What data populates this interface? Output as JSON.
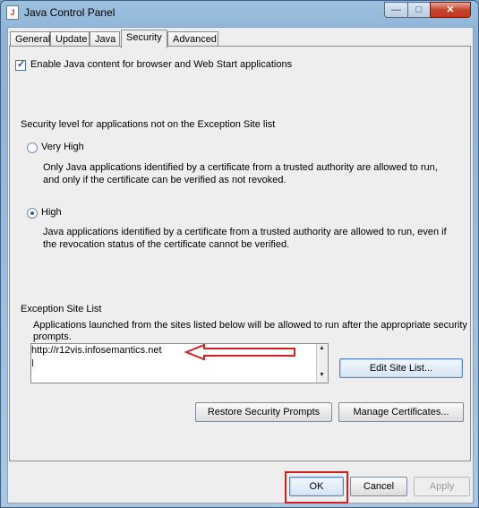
{
  "window": {
    "title": "Java Control Panel",
    "app_icon_glyph": "J",
    "minimize_glyph": "—",
    "maximize_glyph": "□",
    "close_glyph": "✕"
  },
  "tabs": [
    {
      "label": "General"
    },
    {
      "label": "Update"
    },
    {
      "label": "Java"
    },
    {
      "label": "Security"
    },
    {
      "label": "Advanced"
    }
  ],
  "security": {
    "enable_checkbox_label": "Enable Java content for browser and Web Start applications",
    "enable_checked": true,
    "level_heading": "Security level for applications not on the Exception Site list",
    "very_high_label": "Very High",
    "very_high_desc_1": "Only Java applications identified by a certificate from a trusted authority are allowed to run,",
    "very_high_desc_2": "and only if the certificate can be verified as not revoked.",
    "high_label": "High",
    "high_selected": true,
    "high_desc_1": "Java applications identified by a certificate from a trusted authority are allowed to run, even if",
    "high_desc_2": "the revocation status of the certificate cannot be verified.",
    "exception_heading": "Exception Site List",
    "exception_desc_1": "Applications launched from the sites listed below will be allowed to run after the appropriate security",
    "exception_desc_2": "prompts.",
    "site_entry": "http://r12vis.infosemantics.net",
    "edit_site_list_label": "Edit Site List...",
    "restore_prompts_label": "Restore Security Prompts",
    "manage_certs_label": "Manage Certificates..."
  },
  "footer": {
    "ok_label": "OK",
    "cancel_label": "Cancel",
    "apply_label": "Apply"
  },
  "annotation": {
    "highlight_color": "#d61d24"
  }
}
